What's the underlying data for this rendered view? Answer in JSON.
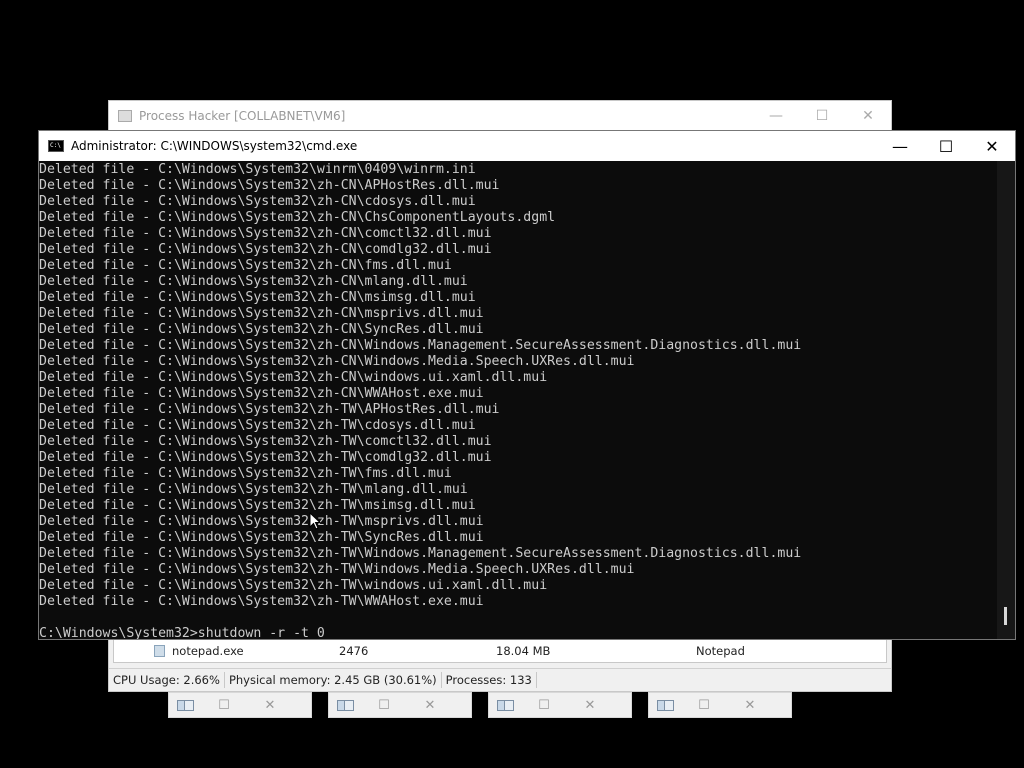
{
  "process_hacker": {
    "title": "Process Hacker [COLLABNET\\VM6]",
    "row": {
      "name": "notepad.exe",
      "pid": "2476",
      "memory": "18.04 MB",
      "description": "Notepad"
    },
    "status": {
      "cpu": "CPU Usage: 2.66%",
      "memory": "Physical memory: 2.45 GB (30.61%)",
      "processes": "Processes: 133"
    }
  },
  "cmd": {
    "title": "Administrator: C:\\WINDOWS\\system32\\cmd.exe",
    "icon_text": "C:\\",
    "lines": [
      "Deleted file - C:\\Windows\\System32\\winrm\\0409\\winrm.ini",
      "Deleted file - C:\\Windows\\System32\\zh-CN\\APHostRes.dll.mui",
      "Deleted file - C:\\Windows\\System32\\zh-CN\\cdosys.dll.mui",
      "Deleted file - C:\\Windows\\System32\\zh-CN\\ChsComponentLayouts.dgml",
      "Deleted file - C:\\Windows\\System32\\zh-CN\\comctl32.dll.mui",
      "Deleted file - C:\\Windows\\System32\\zh-CN\\comdlg32.dll.mui",
      "Deleted file - C:\\Windows\\System32\\zh-CN\\fms.dll.mui",
      "Deleted file - C:\\Windows\\System32\\zh-CN\\mlang.dll.mui",
      "Deleted file - C:\\Windows\\System32\\zh-CN\\msimsg.dll.mui",
      "Deleted file - C:\\Windows\\System32\\zh-CN\\msprivs.dll.mui",
      "Deleted file - C:\\Windows\\System32\\zh-CN\\SyncRes.dll.mui",
      "Deleted file - C:\\Windows\\System32\\zh-CN\\Windows.Management.SecureAssessment.Diagnostics.dll.mui",
      "Deleted file - C:\\Windows\\System32\\zh-CN\\Windows.Media.Speech.UXRes.dll.mui",
      "Deleted file - C:\\Windows\\System32\\zh-CN\\windows.ui.xaml.dll.mui",
      "Deleted file - C:\\Windows\\System32\\zh-CN\\WWAHost.exe.mui",
      "Deleted file - C:\\Windows\\System32\\zh-TW\\APHostRes.dll.mui",
      "Deleted file - C:\\Windows\\System32\\zh-TW\\cdosys.dll.mui",
      "Deleted file - C:\\Windows\\System32\\zh-TW\\comctl32.dll.mui",
      "Deleted file - C:\\Windows\\System32\\zh-TW\\comdlg32.dll.mui",
      "Deleted file - C:\\Windows\\System32\\zh-TW\\fms.dll.mui",
      "Deleted file - C:\\Windows\\System32\\zh-TW\\mlang.dll.mui",
      "Deleted file - C:\\Windows\\System32\\zh-TW\\msimsg.dll.mui",
      "Deleted file - C:\\Windows\\System32\\zh-TW\\msprivs.dll.mui",
      "Deleted file - C:\\Windows\\System32\\zh-TW\\SyncRes.dll.mui",
      "Deleted file - C:\\Windows\\System32\\zh-TW\\Windows.Management.SecureAssessment.Diagnostics.dll.mui",
      "Deleted file - C:\\Windows\\System32\\zh-TW\\Windows.Media.Speech.UXRes.dll.mui",
      "Deleted file - C:\\Windows\\System32\\zh-TW\\windows.ui.xaml.dll.mui",
      "Deleted file - C:\\Windows\\System32\\zh-TW\\WWAHost.exe.mui",
      "",
      "C:\\Windows\\System32>shutdown -r -t 0"
    ]
  },
  "controls": {
    "minimize": "—",
    "maximize": "☐",
    "close": "✕"
  },
  "colors": {
    "console_bg": "#0c0c0c",
    "console_text": "#cccccc",
    "desktop": "#000000"
  }
}
